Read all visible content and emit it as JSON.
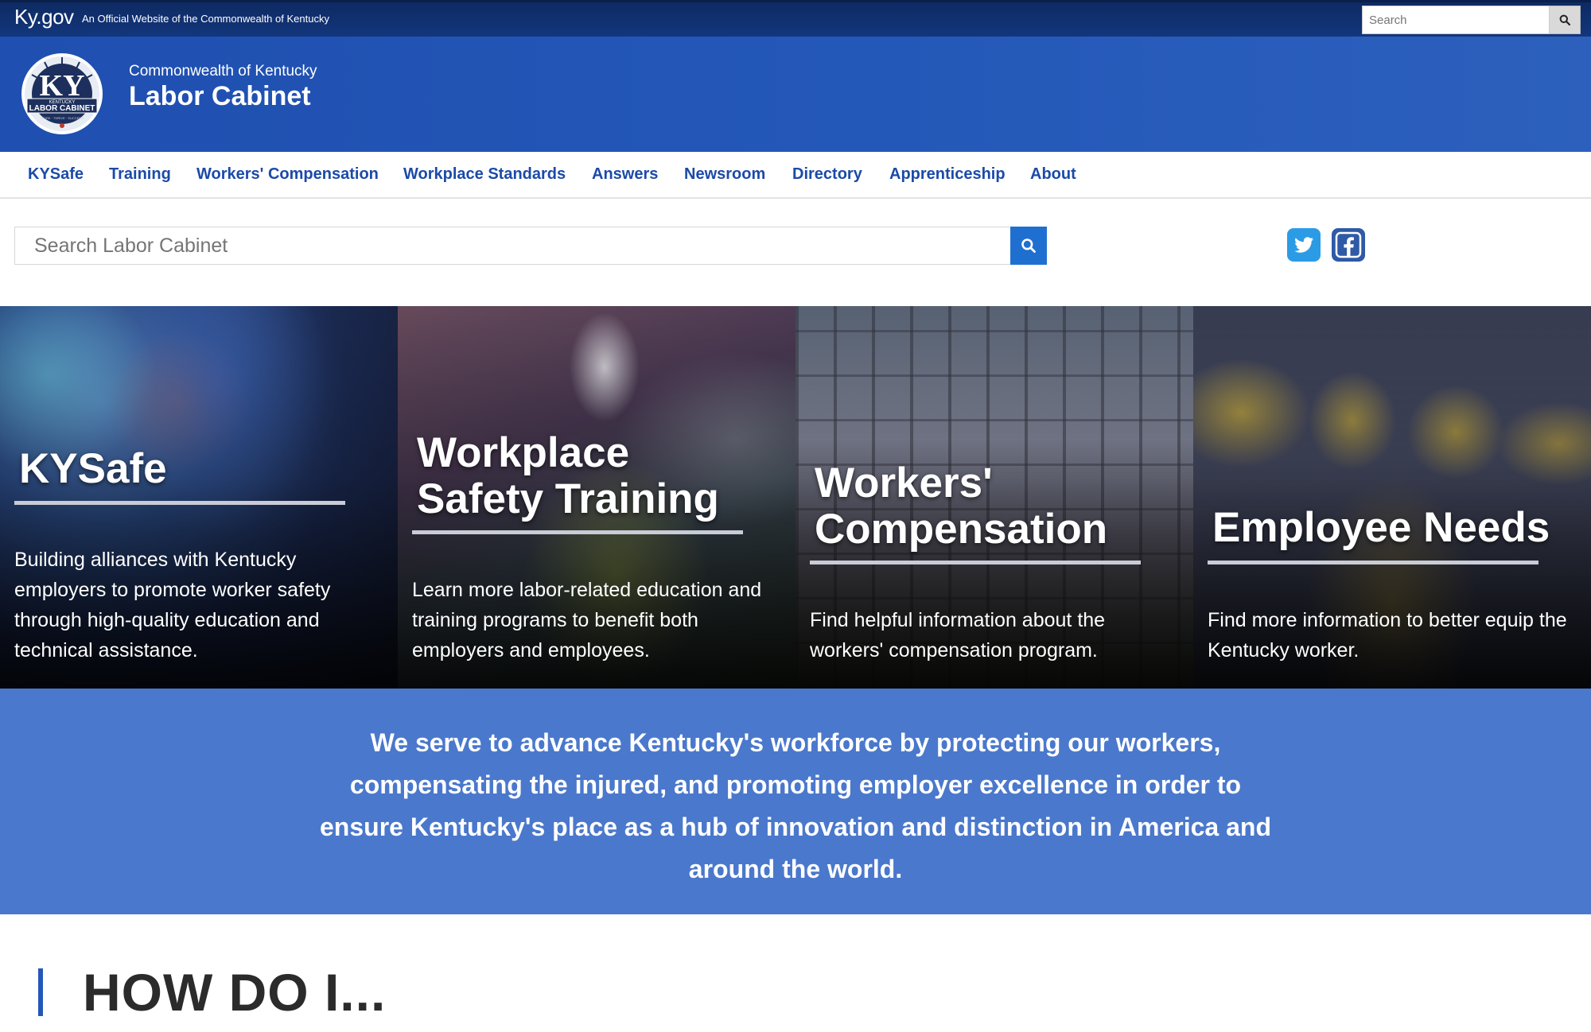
{
  "kygov": {
    "brand": "Ky.gov",
    "official": "An Official Website of the Commonwealth of Kentucky",
    "search_placeholder": "Search",
    "search_icon": "search-icon"
  },
  "header": {
    "seal_text": "KY",
    "seal_ring_top": "KENTUCKY",
    "seal_ring_label": "LABOR CABINET",
    "seal_motto": "WORK · THRIVE · SUCCEED",
    "subtitle": "Commonwealth of Kentucky",
    "title": "Labor Cabinet"
  },
  "nav": {
    "items": [
      {
        "label": "KYSafe"
      },
      {
        "label": "Training"
      },
      {
        "label": "Workers' Compensation"
      },
      {
        "label": "Workplace Standards"
      },
      {
        "label": "Answers"
      },
      {
        "label": "Newsroom"
      },
      {
        "label": "Directory"
      },
      {
        "label": "Apprenticeship"
      },
      {
        "label": "About"
      }
    ]
  },
  "site_search": {
    "placeholder": "Search Labor Cabinet",
    "icon": "search-icon"
  },
  "social": {
    "twitter_icon": "twitter-icon",
    "facebook_icon": "facebook-icon",
    "twitter_color": "#2c9be6",
    "facebook_color": "#2e5aa6"
  },
  "panels": [
    {
      "title": "KYSafe",
      "text": "Building alliances with Kentucky employers to promote worker safety through high-quality education and technical assistance."
    },
    {
      "title": "Workplace\nSafety Training",
      "text": "Learn more labor-related education and training programs to benefit both employers and employees."
    },
    {
      "title": "Workers'\nCompensation",
      "text": "Find helpful information about the workers' compensation program."
    },
    {
      "title": "Employee Needs",
      "text": "Find more information to better equip the Kentucky worker."
    }
  ],
  "mission": {
    "text": "We serve to advance Kentucky's workforce by protecting our workers, compensating the injured, and promoting employer excellence in order to ensure Kentucky's place as a hub of innovation and distinction in America and around the world."
  },
  "howdo": {
    "title": "HOW DO I..."
  },
  "colors": {
    "brand_blue": "#2458b8",
    "nav_link": "#1b4aa8",
    "mission_bg": "#4a78cc",
    "search_button": "#1f6fd1"
  }
}
